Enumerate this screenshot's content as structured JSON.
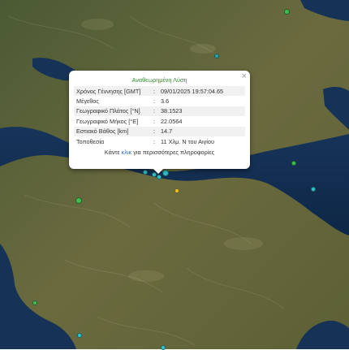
{
  "popup": {
    "title": "Αναθεωρημένη Λύση",
    "close_label": "×",
    "rows": [
      {
        "label": "Χρόνος Γέννησης [GMT]",
        "value": "09/01/2025 19:57:04.65"
      },
      {
        "label": "Μέγεθος",
        "value": "3.6"
      },
      {
        "label": "Γεωγραφικό Πλάτος [°N]",
        "value": "38.1523"
      },
      {
        "label": "Γεωγραφικό Μήκος [°E]",
        "value": "22.0564"
      },
      {
        "label": "Εστιακό Βάθος [km]",
        "value": "14.7"
      },
      {
        "label": "Τοποθεσία",
        "value": "11 Χλμ. Ν του Αιγίου"
      }
    ],
    "separator": ":",
    "more_prefix": "Κάντε",
    "more_link": "κλικ",
    "more_suffix": "για περισσότερες πληροφορίες"
  },
  "colors": {
    "marker_cyan": "#2fc4c9",
    "marker_green": "#3fbf4f",
    "marker_yellow": "#e3c22a",
    "marker_teal": "#2aa6a8"
  }
}
